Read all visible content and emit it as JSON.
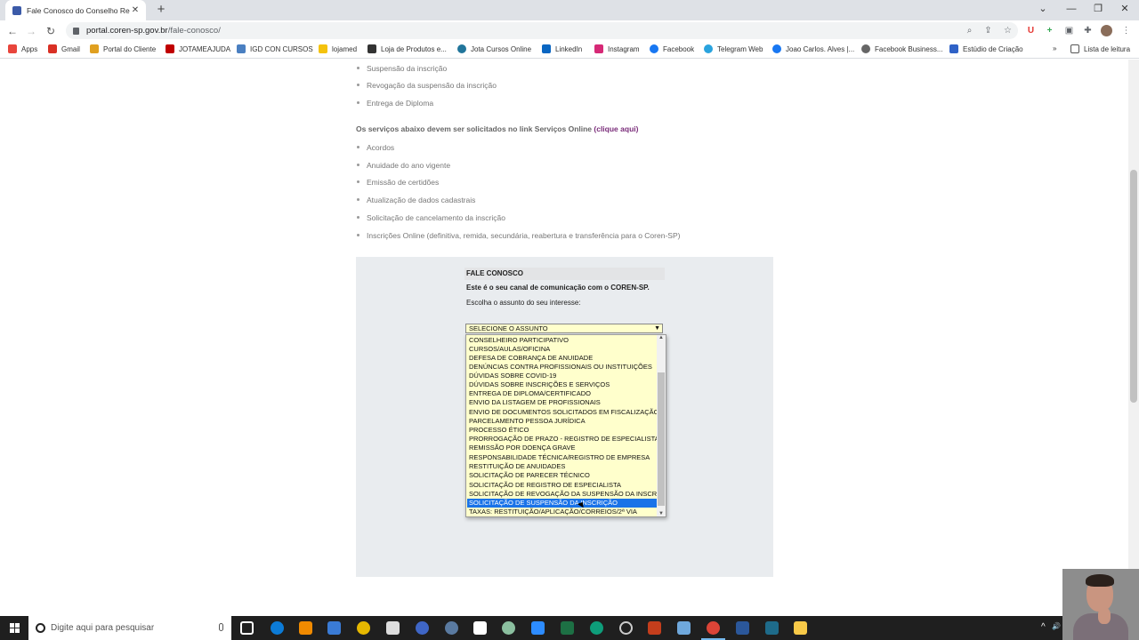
{
  "browser": {
    "tab_title": "Fale Conosco do Conselho Regio",
    "tab_close": "✕",
    "new_tab": "+",
    "url_domain": "portal.coren-sp.gov.br",
    "url_path": "/fale-conosco/",
    "window_controls": [
      "⌄",
      "—",
      "❐",
      "✕"
    ]
  },
  "bookmarks": {
    "items": [
      {
        "label": "Apps",
        "color": "#e8453c"
      },
      {
        "label": "Gmail",
        "color": "#d93025"
      },
      {
        "label": "Portal do Cliente",
        "color": "#e0a020"
      },
      {
        "label": "JOTAMEAJUDA",
        "color": "#c00000"
      },
      {
        "label": "IGD CON CURSOS",
        "color": "#4a7fc1"
      },
      {
        "label": "lojamed",
        "color": "#f4c20d"
      },
      {
        "label": "Loja de Produtos e...",
        "color": "#333333"
      },
      {
        "label": "Jota Cursos Online",
        "color": "#21759b"
      },
      {
        "label": "LinkedIn",
        "color": "#0a66c2"
      },
      {
        "label": "Instagram",
        "color": "#d62976"
      },
      {
        "label": "Facebook",
        "color": "#1877f2"
      },
      {
        "label": "Telegram Web",
        "color": "#2aa3de"
      },
      {
        "label": "Joao Carlos. Alves |...",
        "color": "#1877f2"
      },
      {
        "label": "Facebook Business...",
        "color": "#666666"
      },
      {
        "label": "Estúdio de Criação",
        "color": "#2f62c7"
      }
    ],
    "more": "»",
    "reading_list": "Lista de leitura"
  },
  "page": {
    "top_list": [
      "Suspensão da inscrição",
      "Revogação da suspensão da inscrição",
      "Entrega de Diploma"
    ],
    "notice_text": "Os serviços abaixo devem ser solicitados no link Serviços Online ",
    "notice_link": "(clique aqui)",
    "online_list": [
      "Acordos",
      "Anuidade do ano vigente",
      "Emissão de certidões",
      "Atualização de dados cadastrais",
      "Solicitação de cancelamento da inscrição",
      "Inscrições Online (definitiva, remida, secundária, reabertura e transferência para o Coren-SP)"
    ],
    "form": {
      "heading": "FALE CONOSCO",
      "intro": "Este é o seu canal de comunicação com o COREN-SP.",
      "prompt": "Escolha o assunto do seu interesse:",
      "select_value": "SELECIONE O ASSUNTO",
      "options": [
        "CONSELHEIRO PARTICIPATIVO",
        "CURSOS/AULAS/OFICINA",
        "DEFESA DE COBRANÇA DE ANUIDADE",
        "DENÚNCIAS CONTRA PROFISSIONAIS OU INSTITUIÇÕES",
        "DÚVIDAS SOBRE COVID-19",
        "DÚVIDAS SOBRE INSCRIÇÕES E SERVIÇOS",
        "ENTREGA DE DIPLOMA/CERTIFICADO",
        "ENVIO DA LISTAGEM DE PROFISSIONAIS",
        "ENVIO DE DOCUMENTOS SOLICITADOS EM FISCALIZAÇÃO",
        "PARCELAMENTO PESSOA JURÍDICA",
        "PROCESSO ÉTICO",
        "PRORROGAÇÃO DE PRAZO - REGISTRO DE ESPECIALISTA",
        "REMISSÃO POR DOENÇA GRAVE",
        "RESPONSABILIDADE TÉCNICA/REGISTRO DE EMPRESA",
        "RESTITUIÇÃO DE ANUIDADES",
        "SOLICITAÇÃO DE PARECER TÉCNICO",
        "SOLICITAÇÃO DE REGISTRO DE ESPECIALISTA",
        "SOLICITAÇÃO DE REVOGAÇÃO DA SUSPENSÃO DA INSCRIÇÃO",
        "SOLICITAÇÃO DE SUSPENSÃO DA INSCRIÇÃO",
        "TAXAS: RESTITUIÇÃO/APLICAÇÃO/CORREIOS/2ª VIA"
      ],
      "highlighted_option": "SOLICITAÇÃO DE SUSPENSÃO DA INSCRIÇÃO"
    }
  },
  "taskbar": {
    "search_placeholder": "Digite aqui para pesquisar",
    "tray_arrow": "^",
    "tray_volume": "🔊"
  }
}
